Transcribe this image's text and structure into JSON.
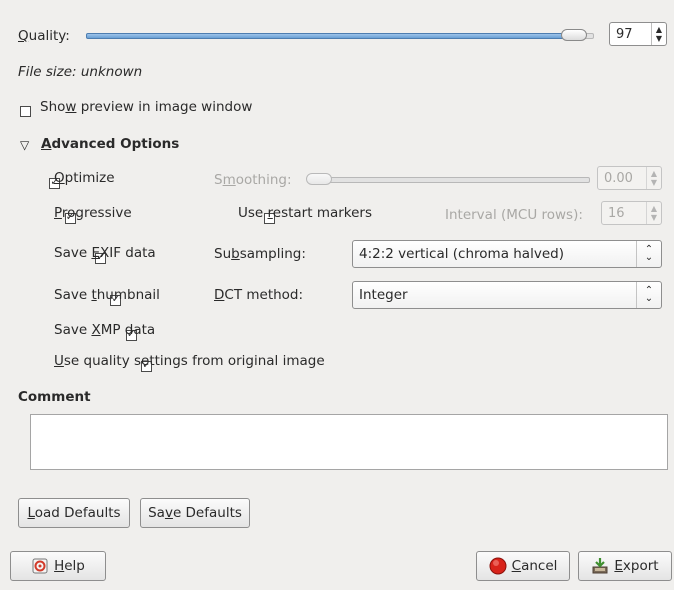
{
  "quality": {
    "label": "Quality:",
    "value": "97",
    "level": 0.97
  },
  "file_size": "File size: unknown",
  "show_preview": {
    "label": "Show preview in image window",
    "checked": false
  },
  "advanced": {
    "title": "Advanced Options",
    "optimize": {
      "label": "Optimize",
      "checked": true
    },
    "progressive": {
      "label": "Progressive",
      "checked": true
    },
    "save_exif": {
      "label": "Save EXIF data",
      "checked": true
    },
    "save_thumbnail": {
      "label": "Save thumbnail",
      "checked": true
    },
    "save_xmp": {
      "label": "Save XMP data",
      "checked": true
    },
    "use_quality": {
      "label": "Use quality settings from original image",
      "checked": true
    },
    "smoothing": {
      "label": "Smoothing:",
      "value": "0.00",
      "level": 0.0
    },
    "restart": {
      "label": "Use restart markers",
      "checked": false
    },
    "interval": {
      "label": "Interval (MCU rows):",
      "value": "16"
    },
    "subsampling": {
      "label": "Subsampling:",
      "value": "4:2:2 vertical (chroma halved)"
    },
    "dct": {
      "label": "DCT method:",
      "value": "Integer"
    }
  },
  "comment": {
    "label": "Comment",
    "value": ""
  },
  "buttons": {
    "load_defaults": "Load Defaults",
    "save_defaults": "Save Defaults",
    "help": "Help",
    "cancel": "Cancel",
    "export": "Export"
  },
  "icons": {
    "triangle": "expander-open-icon",
    "help": "help-icon",
    "cancel": "cancel-icon",
    "export": "export-icon"
  }
}
